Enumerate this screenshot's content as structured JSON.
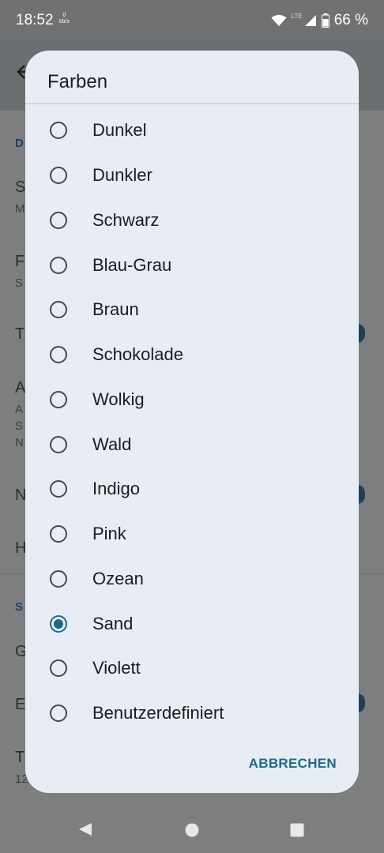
{
  "status_bar": {
    "time": "18:52",
    "speed_value": "0",
    "speed_unit": "kb/s",
    "network": "LTE",
    "battery": "66 %"
  },
  "background": {
    "section_1": "D",
    "items": [
      {
        "title": "S",
        "sub": "M"
      },
      {
        "title": "F",
        "sub": "S"
      },
      {
        "title": "T",
        "sub": ""
      },
      {
        "title": "A",
        "sub": "A"
      },
      {
        "title": "",
        "sub": "S"
      },
      {
        "title": "",
        "sub": "N"
      },
      {
        "title": "N",
        "sub": ""
      },
      {
        "title": "H",
        "sub": ""
      }
    ],
    "section_2": "S",
    "items2": [
      {
        "title": "G",
        "sub": ""
      },
      {
        "title": "E",
        "sub": ""
      },
      {
        "title": "T",
        "sub": "12"
      }
    ]
  },
  "dialog": {
    "title": "Farben",
    "options": [
      {
        "label": "Dunkel",
        "selected": false
      },
      {
        "label": "Dunkler",
        "selected": false
      },
      {
        "label": "Schwarz",
        "selected": false
      },
      {
        "label": "Blau-Grau",
        "selected": false
      },
      {
        "label": "Braun",
        "selected": false
      },
      {
        "label": "Schokolade",
        "selected": false
      },
      {
        "label": "Wolkig",
        "selected": false
      },
      {
        "label": "Wald",
        "selected": false
      },
      {
        "label": "Indigo",
        "selected": false
      },
      {
        "label": "Pink",
        "selected": false
      },
      {
        "label": "Ozean",
        "selected": false
      },
      {
        "label": "Sand",
        "selected": true
      },
      {
        "label": "Violett",
        "selected": false
      },
      {
        "label": "Benutzerdefiniert",
        "selected": false
      }
    ],
    "cancel_label": "ABBRECHEN"
  },
  "colors": {
    "accent": "#1b6a8a",
    "dialog_bg": "#e8edf5",
    "scrim": "#7d7e80"
  },
  "icons": {
    "wifi": "wifi-icon",
    "signal": "signal-icon",
    "battery": "battery-icon",
    "back": "back-arrow-icon",
    "nav_back": "nav-back-icon",
    "nav_home": "nav-home-icon",
    "nav_recents": "nav-recents-icon"
  }
}
